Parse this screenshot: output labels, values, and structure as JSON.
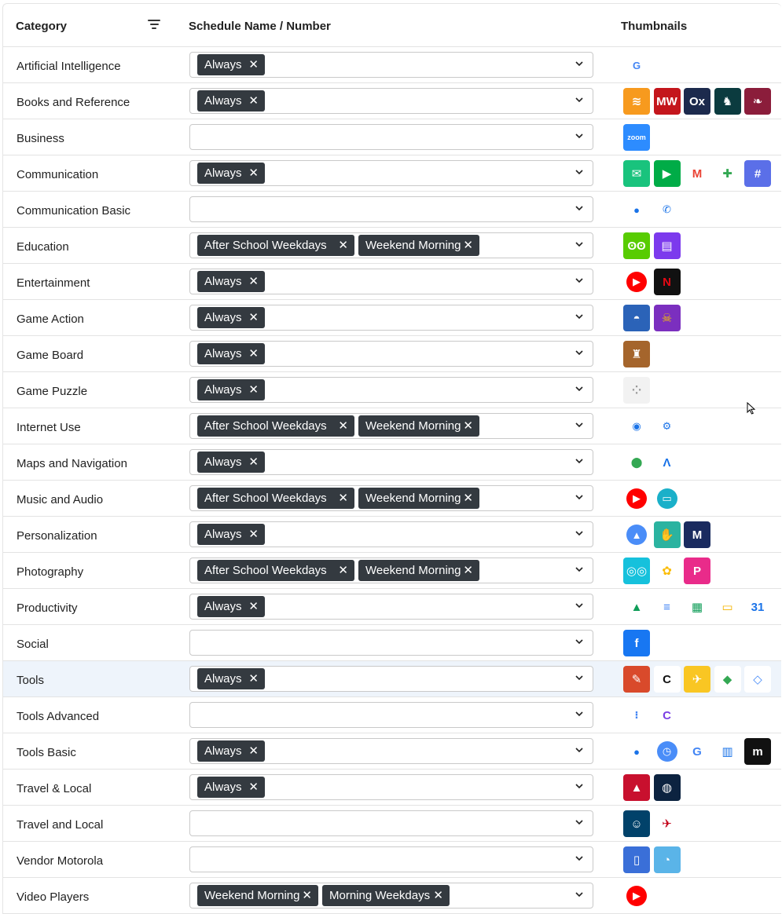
{
  "header": {
    "category": "Category",
    "schedule": "Schedule Name / Number",
    "thumbnails": "Thumbnails"
  },
  "chip_remove_glyph": "✕",
  "rows": [
    {
      "category": "Artificial Intelligence",
      "chips": [
        "Always"
      ],
      "icons": [
        {
          "name": "google-icon",
          "glyph": "G",
          "color": "#ffffff",
          "fg": "#4285F4",
          "style": "small"
        }
      ]
    },
    {
      "category": "Books and Reference",
      "chips": [
        "Always"
      ],
      "icons": [
        {
          "name": "audible-icon",
          "glyph": "≋",
          "color": "#f79a1e"
        },
        {
          "name": "merriam-webster-icon",
          "glyph": "MW",
          "color": "#c4161c"
        },
        {
          "name": "oxford-dictionary-icon",
          "glyph": "Ox",
          "color": "#1c2a4d"
        },
        {
          "name": "reader-icon",
          "glyph": "♞",
          "color": "#0b3b3f"
        },
        {
          "name": "book-app-icon",
          "glyph": "❧",
          "color": "#8b1d3b"
        }
      ]
    },
    {
      "category": "Business",
      "chips": [],
      "icons": [
        {
          "name": "zoom-icon",
          "glyph": "zoom",
          "color": "#2d8cff"
        }
      ]
    },
    {
      "category": "Communication",
      "chips": [
        "Always"
      ],
      "icons": [
        {
          "name": "messenger-icon",
          "glyph": "✉",
          "color": "#19c37d"
        },
        {
          "name": "google-meet-icon",
          "glyph": "▶",
          "color": "#00ac47"
        },
        {
          "name": "gmail-icon",
          "glyph": "M",
          "color": "#ffffff",
          "fg": "#ea4335"
        },
        {
          "name": "google-play-games-icon",
          "glyph": "✚",
          "color": "#ffffff",
          "fg": "#34a853"
        },
        {
          "name": "groupme-icon",
          "glyph": "#",
          "color": "#5b6fe8"
        }
      ]
    },
    {
      "category": "Communication Basic",
      "chips": [],
      "icons": [
        {
          "name": "messages-icon",
          "glyph": "●",
          "color": "#ffffff",
          "fg": "#1a73e8",
          "style": "small"
        },
        {
          "name": "phone-icon",
          "glyph": "✆",
          "color": "#ffffff",
          "fg": "#1a73e8",
          "style": "small"
        }
      ]
    },
    {
      "category": "Education",
      "chips": [
        "After School Weekdays",
        "Weekend Morning"
      ],
      "icons": [
        {
          "name": "duolingo-icon",
          "glyph": "ʘʘ",
          "color": "#58cc02"
        },
        {
          "name": "quizlet-icon",
          "glyph": "▤",
          "color": "#7c3aed"
        }
      ]
    },
    {
      "category": "Entertainment",
      "chips": [
        "Always"
      ],
      "icons": [
        {
          "name": "youtube-icon",
          "glyph": "▶",
          "color": "#ff0000",
          "style": "small"
        },
        {
          "name": "netflix-icon",
          "glyph": "N",
          "color": "#111111",
          "fg": "#e50914"
        }
      ]
    },
    {
      "category": "Game Action",
      "chips": [
        "Always"
      ],
      "icons": [
        {
          "name": "pokemon-go-icon",
          "glyph": "◓",
          "color": "#2b63b8"
        },
        {
          "name": "brawl-stars-icon",
          "glyph": "☠",
          "color": "#7b2fbf",
          "fg": "#f7c400"
        }
      ]
    },
    {
      "category": "Game Board",
      "chips": [
        "Always"
      ],
      "icons": [
        {
          "name": "board-game-icon",
          "glyph": "♜",
          "color": "#a5652c"
        }
      ]
    },
    {
      "category": "Game Puzzle",
      "chips": [
        "Always"
      ],
      "icons": [
        {
          "name": "puzzle-game-icon",
          "glyph": "⁘",
          "color": "#f2f2f2",
          "fg": "#999"
        }
      ]
    },
    {
      "category": "Internet Use",
      "chips": [
        "After School Weekdays",
        "Weekend Morning"
      ],
      "icons": [
        {
          "name": "chrome-icon",
          "glyph": "◉",
          "color": "#ffffff",
          "fg": "#1a73e8",
          "style": "small"
        },
        {
          "name": "settings-gear-icon",
          "glyph": "⚙",
          "color": "#ffffff",
          "fg": "#1a73e8",
          "style": "small"
        }
      ]
    },
    {
      "category": "Maps and Navigation",
      "chips": [
        "Always"
      ],
      "icons": [
        {
          "name": "google-maps-icon",
          "glyph": "⬤",
          "color": "#ffffff",
          "fg": "#34a853",
          "style": "small"
        },
        {
          "name": "android-auto-icon",
          "glyph": "Λ",
          "color": "#ffffff",
          "fg": "#1a73e8"
        }
      ]
    },
    {
      "category": "Music and Audio",
      "chips": [
        "After School Weekdays",
        "Weekend Morning"
      ],
      "icons": [
        {
          "name": "youtube-music-icon",
          "glyph": "▶",
          "color": "#ff0000",
          "style": "small"
        },
        {
          "name": "radio-icon",
          "glyph": "▭",
          "color": "#1ab0c9",
          "style": "small"
        }
      ]
    },
    {
      "category": "Personalization",
      "chips": [
        "Always"
      ],
      "icons": [
        {
          "name": "wallpapers-icon",
          "glyph": "▲",
          "color": "#4a8df8",
          "style": "small"
        },
        {
          "name": "gesture-icon",
          "glyph": "✋",
          "color": "#2bb3a0"
        },
        {
          "name": "motorola-icon",
          "glyph": "M",
          "color": "#1a2b5f"
        }
      ]
    },
    {
      "category": "Photography",
      "chips": [
        "After School Weekdays",
        "Weekend Morning"
      ],
      "icons": [
        {
          "name": "camera-app-icon",
          "glyph": "◎◎",
          "color": "#16c1dc"
        },
        {
          "name": "google-photos-icon",
          "glyph": "✿",
          "color": "#ffffff",
          "fg": "#fbbc04"
        },
        {
          "name": "picsart-icon",
          "glyph": "P",
          "color": "#e92b8a"
        }
      ]
    },
    {
      "category": "Productivity",
      "chips": [
        "Always"
      ],
      "icons": [
        {
          "name": "google-drive-icon",
          "glyph": "▲",
          "color": "#ffffff",
          "fg": "#0f9d58"
        },
        {
          "name": "google-docs-icon",
          "glyph": "≡",
          "color": "#ffffff",
          "fg": "#4285f4"
        },
        {
          "name": "google-sheets-icon",
          "glyph": "▦",
          "color": "#ffffff",
          "fg": "#0f9d58"
        },
        {
          "name": "google-slides-icon",
          "glyph": "▭",
          "color": "#ffffff",
          "fg": "#f4b400"
        },
        {
          "name": "google-calendar-icon",
          "glyph": "31",
          "color": "#ffffff",
          "fg": "#1a73e8"
        }
      ]
    },
    {
      "category": "Social",
      "chips": [],
      "icons": [
        {
          "name": "facebook-icon",
          "glyph": "f",
          "color": "#1877f2"
        }
      ]
    },
    {
      "category": "Tools",
      "chips": [
        "Always"
      ],
      "highlight": true,
      "icons": [
        {
          "name": "art-tool-icon",
          "glyph": "✎",
          "color": "#d94a2b"
        },
        {
          "name": "c-logo-icon",
          "glyph": "C",
          "color": "#ffffff",
          "fg": "#111"
        },
        {
          "name": "cruise-icon",
          "glyph": "✈",
          "color": "#f9c623"
        },
        {
          "name": "kite-icon",
          "glyph": "◆",
          "color": "#ffffff",
          "fg": "#34a853"
        },
        {
          "name": "diamond-outline-icon",
          "glyph": "◇",
          "color": "#ffffff",
          "fg": "#4a8df8"
        }
      ]
    },
    {
      "category": "Tools Advanced",
      "chips": [],
      "icons": [
        {
          "name": "dots-arrow-icon",
          "glyph": "⁝",
          "color": "#ffffff",
          "fg": "#4285f4",
          "style": "small"
        },
        {
          "name": "c-purple-icon",
          "glyph": "C",
          "color": "#ffffff",
          "fg": "#7b3fe4"
        }
      ]
    },
    {
      "category": "Tools Basic",
      "chips": [
        "Always"
      ],
      "icons": [
        {
          "name": "contacts-icon",
          "glyph": "●",
          "color": "#ffffff",
          "fg": "#1a73e8",
          "style": "small"
        },
        {
          "name": "clock-icon",
          "glyph": "◷",
          "color": "#4a8df8",
          "style": "small"
        },
        {
          "name": "gboard-icon",
          "glyph": "G",
          "color": "#ffffff",
          "fg": "#4285f4"
        },
        {
          "name": "keep-notes-icon",
          "glyph": "▥",
          "color": "#ffffff",
          "fg": "#1a73e8"
        },
        {
          "name": "motorola-ready-for-icon",
          "glyph": "m",
          "color": "#111111"
        }
      ]
    },
    {
      "category": "Travel & Local",
      "chips": [
        "Always"
      ],
      "icons": [
        {
          "name": "delta-icon",
          "glyph": "▲",
          "color": "#c8102e"
        },
        {
          "name": "united-icon",
          "glyph": "◍",
          "color": "#0c2340"
        }
      ]
    },
    {
      "category": "Travel and Local",
      "chips": [],
      "icons": [
        {
          "name": "alaska-airlines-icon",
          "glyph": "☺",
          "color": "#01426a"
        },
        {
          "name": "american-airlines-icon",
          "glyph": "✈",
          "color": "#ffffff",
          "fg": "#c30019"
        }
      ]
    },
    {
      "category": "Vendor Motorola",
      "chips": [],
      "icons": [
        {
          "name": "motorola-device-icon",
          "glyph": "▯",
          "color": "#3a6fd8"
        },
        {
          "name": "motorola-chat-icon",
          "glyph": "◔",
          "color": "#5ab4e8"
        }
      ]
    },
    {
      "category": "Video Players",
      "chips": [
        "Weekend Morning",
        "Morning Weekdays"
      ],
      "icons": [
        {
          "name": "youtube-icon",
          "glyph": "▶",
          "color": "#ff0000",
          "style": "small"
        }
      ]
    }
  ]
}
